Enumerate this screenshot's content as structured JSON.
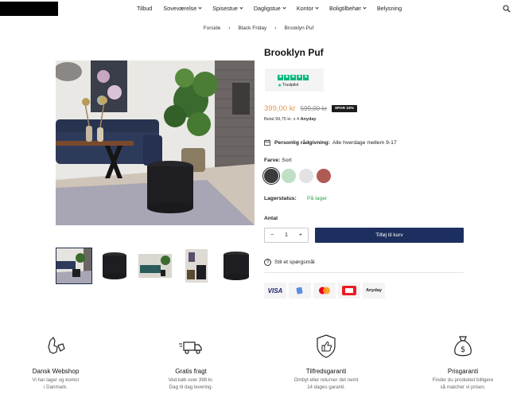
{
  "header": {
    "nav": [
      {
        "label": "Tilbud",
        "has_dropdown": false
      },
      {
        "label": "Soveværelse",
        "has_dropdown": true
      },
      {
        "label": "Spisestue",
        "has_dropdown": true
      },
      {
        "label": "Dagligstue",
        "has_dropdown": true
      },
      {
        "label": "Kontor",
        "has_dropdown": true
      },
      {
        "label": "Boligtilbehør",
        "has_dropdown": true
      },
      {
        "label": "Belysning",
        "has_dropdown": false
      }
    ],
    "search_icon": "search-icon"
  },
  "breadcrumb": [
    "Forside",
    "Black Friday",
    "Brooklyn Puf"
  ],
  "breadcrumb_separator": "›",
  "product": {
    "title": "Brooklyn Puf",
    "trustpilot_label": "Trustpilot",
    "price_now": "399,00 kr",
    "price_old": "599,00 kr",
    "discount_badge": "SPAR 33%",
    "anyday_prefix": "Betal 99,75 kr. x 4",
    "anyday_brand": "Anyday",
    "advice_title": "Personlig rådgivning:",
    "advice_text": "Alle hverdage mellem 9-17",
    "color_label": "Farve:",
    "color_value": "Sort",
    "swatches": [
      "#3b3b3b",
      "#bfe0c6",
      "#e2e2e2",
      "#b05a54"
    ],
    "stock_label": "Lagerstatus:",
    "stock_value": "På lager",
    "qty_label": "Antal",
    "qty_minus": "−",
    "qty_value": "1",
    "qty_plus": "+",
    "add_to_cart": "Tilføj til kurv",
    "ask_question": "Stil et spørgsmål",
    "payment_methods": [
      "VISA",
      "Apple Pay",
      "Mastercard",
      "Dankort",
      "Anyday"
    ],
    "payment_visa_text": "VISA",
    "payment_anyday_text": "Anyday"
  },
  "features": [
    {
      "icon": "denmark-map-icon",
      "title": "Dansk Webshop",
      "desc1": "Vi har lager og kontor",
      "desc2": "i Danmark."
    },
    {
      "icon": "delivery-truck-icon",
      "title": "Gratis fragt",
      "desc1": "Ved køb over 398 kr.",
      "desc2": "Dag til dag levering."
    },
    {
      "icon": "thumbs-up-shield-icon",
      "title": "Tilfredsgaranti",
      "desc1": "Ombyt eller returner det nemt",
      "desc2": "14 dages garanti."
    },
    {
      "icon": "money-bag-icon",
      "title": "Prisgaranti",
      "desc1": "Finder du produktet billigere",
      "desc2": "så matcher vi prisen."
    }
  ],
  "colors": {
    "accent_price": "#e8944b",
    "cart_button": "#1c2f5e",
    "in_stock": "#2aa64c",
    "trustpilot_green": "#00b67a"
  }
}
